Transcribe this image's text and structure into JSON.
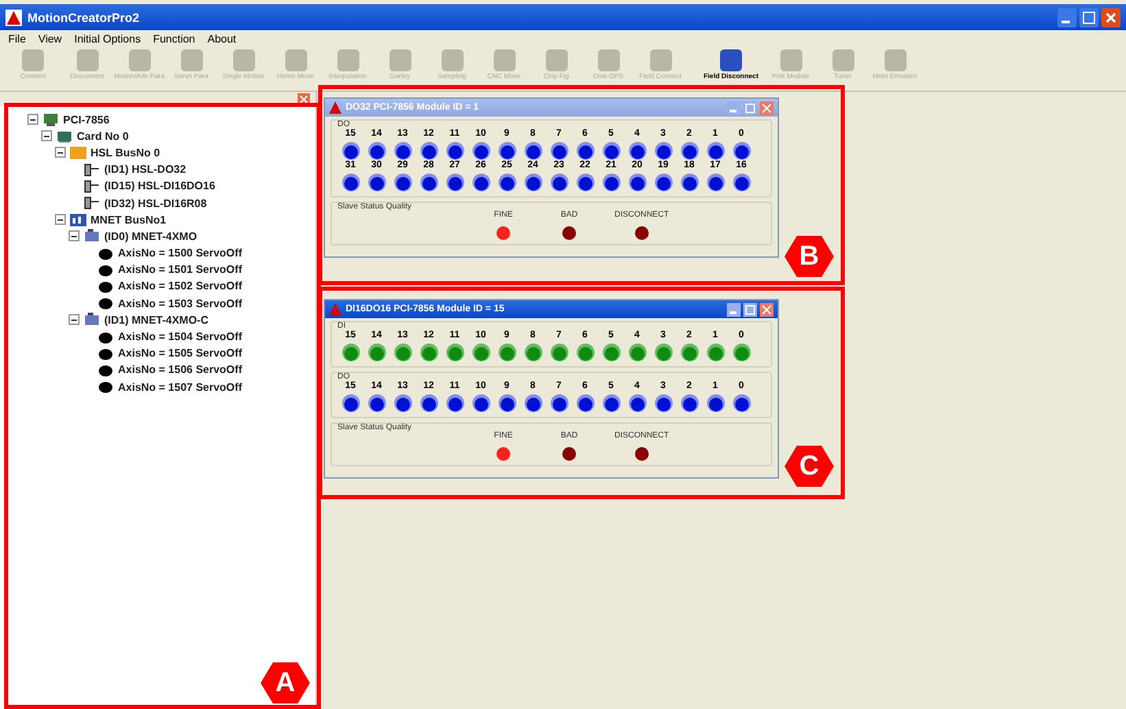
{
  "window": {
    "title": "MotionCreatorPro2"
  },
  "menu": [
    "File",
    "View",
    "Initial Options",
    "Function",
    "About"
  ],
  "toolbar": [
    {
      "label": "Connect",
      "disabled": true
    },
    {
      "label": "Disconnect",
      "disabled": true
    },
    {
      "label": "Motion/Adv Para",
      "disabled": true
    },
    {
      "label": "Servo Para",
      "disabled": true
    },
    {
      "label": "Single Motion",
      "disabled": true
    },
    {
      "label": "Home Move",
      "disabled": true
    },
    {
      "label": "Interpolation",
      "disabled": true
    },
    {
      "label": "Gantry",
      "disabled": true
    },
    {
      "label": "Sampling",
      "disabled": true
    },
    {
      "label": "CNC Move",
      "disabled": true
    },
    {
      "label": "Chip Fig",
      "disabled": true
    },
    {
      "label": "Dow OPS",
      "disabled": true
    },
    {
      "label": "Field Connect",
      "disabled": true
    },
    {
      "label": "Field Disconnect",
      "disabled": false
    },
    {
      "label": "Port Module",
      "disabled": true
    },
    {
      "label": "Tuner",
      "disabled": true
    },
    {
      "label": "Mnet Emulator",
      "disabled": true
    }
  ],
  "tree": [
    {
      "label": "PCI-7856",
      "kind": "computer",
      "expanded": true,
      "children": [
        {
          "label": "Card No 0",
          "kind": "card",
          "expanded": true,
          "children": [
            {
              "label": "HSL BusNo 0",
              "kind": "hsl-bus",
              "expanded": true,
              "children": [
                {
                  "label": "(ID1) HSL-DO32",
                  "kind": "module"
                },
                {
                  "label": "(ID15) HSL-DI16DO16",
                  "kind": "module"
                },
                {
                  "label": "(ID32) HSL-DI16R08",
                  "kind": "module"
                }
              ]
            },
            {
              "label": "MNET BusNo1",
              "kind": "mnet-bus",
              "expanded": true,
              "children": [
                {
                  "label": "(ID0) MNET-4XMO",
                  "kind": "mnet-module",
                  "expanded": true,
                  "children": [
                    {
                      "label": "AxisNo = 1500 ServoOff",
                      "kind": "axis"
                    },
                    {
                      "label": "AxisNo = 1501 ServoOff",
                      "kind": "axis"
                    },
                    {
                      "label": "AxisNo = 1502 ServoOff",
                      "kind": "axis"
                    },
                    {
                      "label": "AxisNo = 1503 ServoOff",
                      "kind": "axis"
                    }
                  ]
                },
                {
                  "label": "(ID1) MNET-4XMO-C",
                  "kind": "mnet-module",
                  "expanded": true,
                  "children": [
                    {
                      "label": "AxisNo = 1504 ServoOff",
                      "kind": "axis"
                    },
                    {
                      "label": "AxisNo = 1505 ServoOff",
                      "kind": "axis"
                    },
                    {
                      "label": "AxisNo = 1506 ServoOff",
                      "kind": "axis"
                    },
                    {
                      "label": "AxisNo = 1507 ServoOff",
                      "kind": "axis"
                    }
                  ]
                }
              ]
            }
          ]
        }
      ]
    }
  ],
  "child_windows": [
    {
      "title": "DO32 PCI-7856 Module ID = 1",
      "active": false,
      "groups": [
        {
          "label": "DO",
          "kind": "output",
          "rows": [
            [
              "15",
              "14",
              "13",
              "12",
              "11",
              "10",
              "9",
              "8",
              "7",
              "6",
              "5",
              "4",
              "3",
              "2",
              "1",
              "0"
            ],
            [
              "31",
              "30",
              "29",
              "28",
              "27",
              "26",
              "25",
              "24",
              "23",
              "22",
              "21",
              "20",
              "19",
              "18",
              "17",
              "16"
            ]
          ]
        }
      ],
      "status": {
        "label": "Slave Status Quality",
        "lights": [
          {
            "label": "FINE",
            "color": "#ff2020"
          },
          {
            "label": "BAD",
            "color": "#8a0000"
          },
          {
            "label": "DISCONNECT",
            "color": "#8a0000"
          }
        ]
      }
    },
    {
      "title": "DI16DO16 PCI-7856 Module ID = 15",
      "active": true,
      "groups": [
        {
          "label": "DI",
          "kind": "input",
          "rows": [
            [
              "15",
              "14",
              "13",
              "12",
              "11",
              "10",
              "9",
              "8",
              "7",
              "6",
              "5",
              "4",
              "3",
              "2",
              "1",
              "0"
            ]
          ]
        },
        {
          "label": "DO",
          "kind": "output",
          "rows": [
            [
              "15",
              "14",
              "13",
              "12",
              "11",
              "10",
              "9",
              "8",
              "7",
              "6",
              "5",
              "4",
              "3",
              "2",
              "1",
              "0"
            ]
          ]
        }
      ],
      "status": {
        "label": "Slave Status Quality",
        "lights": [
          {
            "label": "FINE",
            "color": "#ff2020"
          },
          {
            "label": "BAD",
            "color": "#8a0000"
          },
          {
            "label": "DISCONNECT",
            "color": "#8a0000"
          }
        ]
      }
    }
  ],
  "annotations": [
    {
      "label": "A"
    },
    {
      "label": "B"
    },
    {
      "label": "C"
    }
  ]
}
